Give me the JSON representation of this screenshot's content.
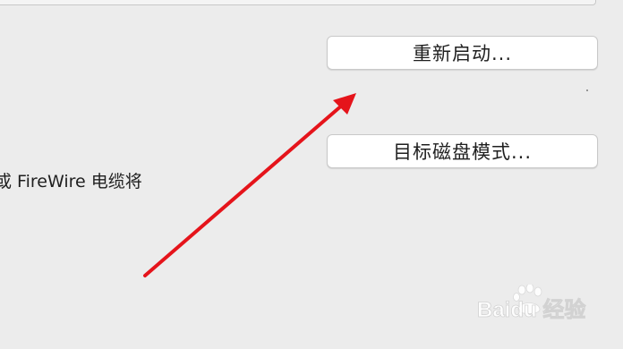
{
  "buttons": {
    "restart_label": "重新启动...",
    "target_disk_label": "目标磁盘模式..."
  },
  "description_text": "或 FireWire 电缆将",
  "watermark_text": "Baidu 经验",
  "colors": {
    "background": "#ececec",
    "arrow": "#e5141b",
    "button_face": "#ffffff"
  },
  "icons": {
    "annotation": "red-arrow-icon",
    "watermark": "baidu-paw-logo"
  }
}
